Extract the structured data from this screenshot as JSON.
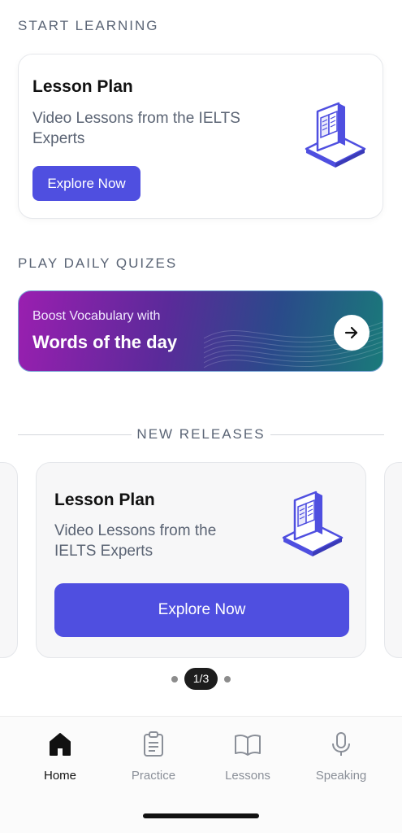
{
  "start_learning": {
    "section_label": "START LEARNING",
    "card": {
      "title": "Lesson Plan",
      "subtitle": "Video Lessons from the IELTS Experts",
      "button_label": "Explore Now",
      "illustration_icon": "book-stack-icon"
    }
  },
  "daily_quizzes": {
    "section_label": "PLAY DAILY QUIZES",
    "banner": {
      "kicker": "Boost Vocabulary with",
      "title": "Words of the day",
      "arrow_icon": "arrow-right-icon"
    }
  },
  "new_releases": {
    "section_label": "NEW RELEASES",
    "card": {
      "title": "Lesson Plan",
      "subtitle": "Video Lessons from the IELTS Experts",
      "button_label": "Explore Now"
    },
    "pager": "1/3"
  },
  "tabbar": {
    "items": [
      {
        "label": "Home",
        "icon": "home-icon",
        "active": true
      },
      {
        "label": "Practice",
        "icon": "clipboard-icon",
        "active": false
      },
      {
        "label": "Lessons",
        "icon": "open-book-icon",
        "active": false
      },
      {
        "label": "Speaking",
        "icon": "microphone-icon",
        "active": false
      }
    ]
  },
  "colors": {
    "accent": "#4f4fe0",
    "section_label": "#5a6475",
    "banner_start": "#9a1fb0",
    "banner_end": "#1a7a7a"
  }
}
